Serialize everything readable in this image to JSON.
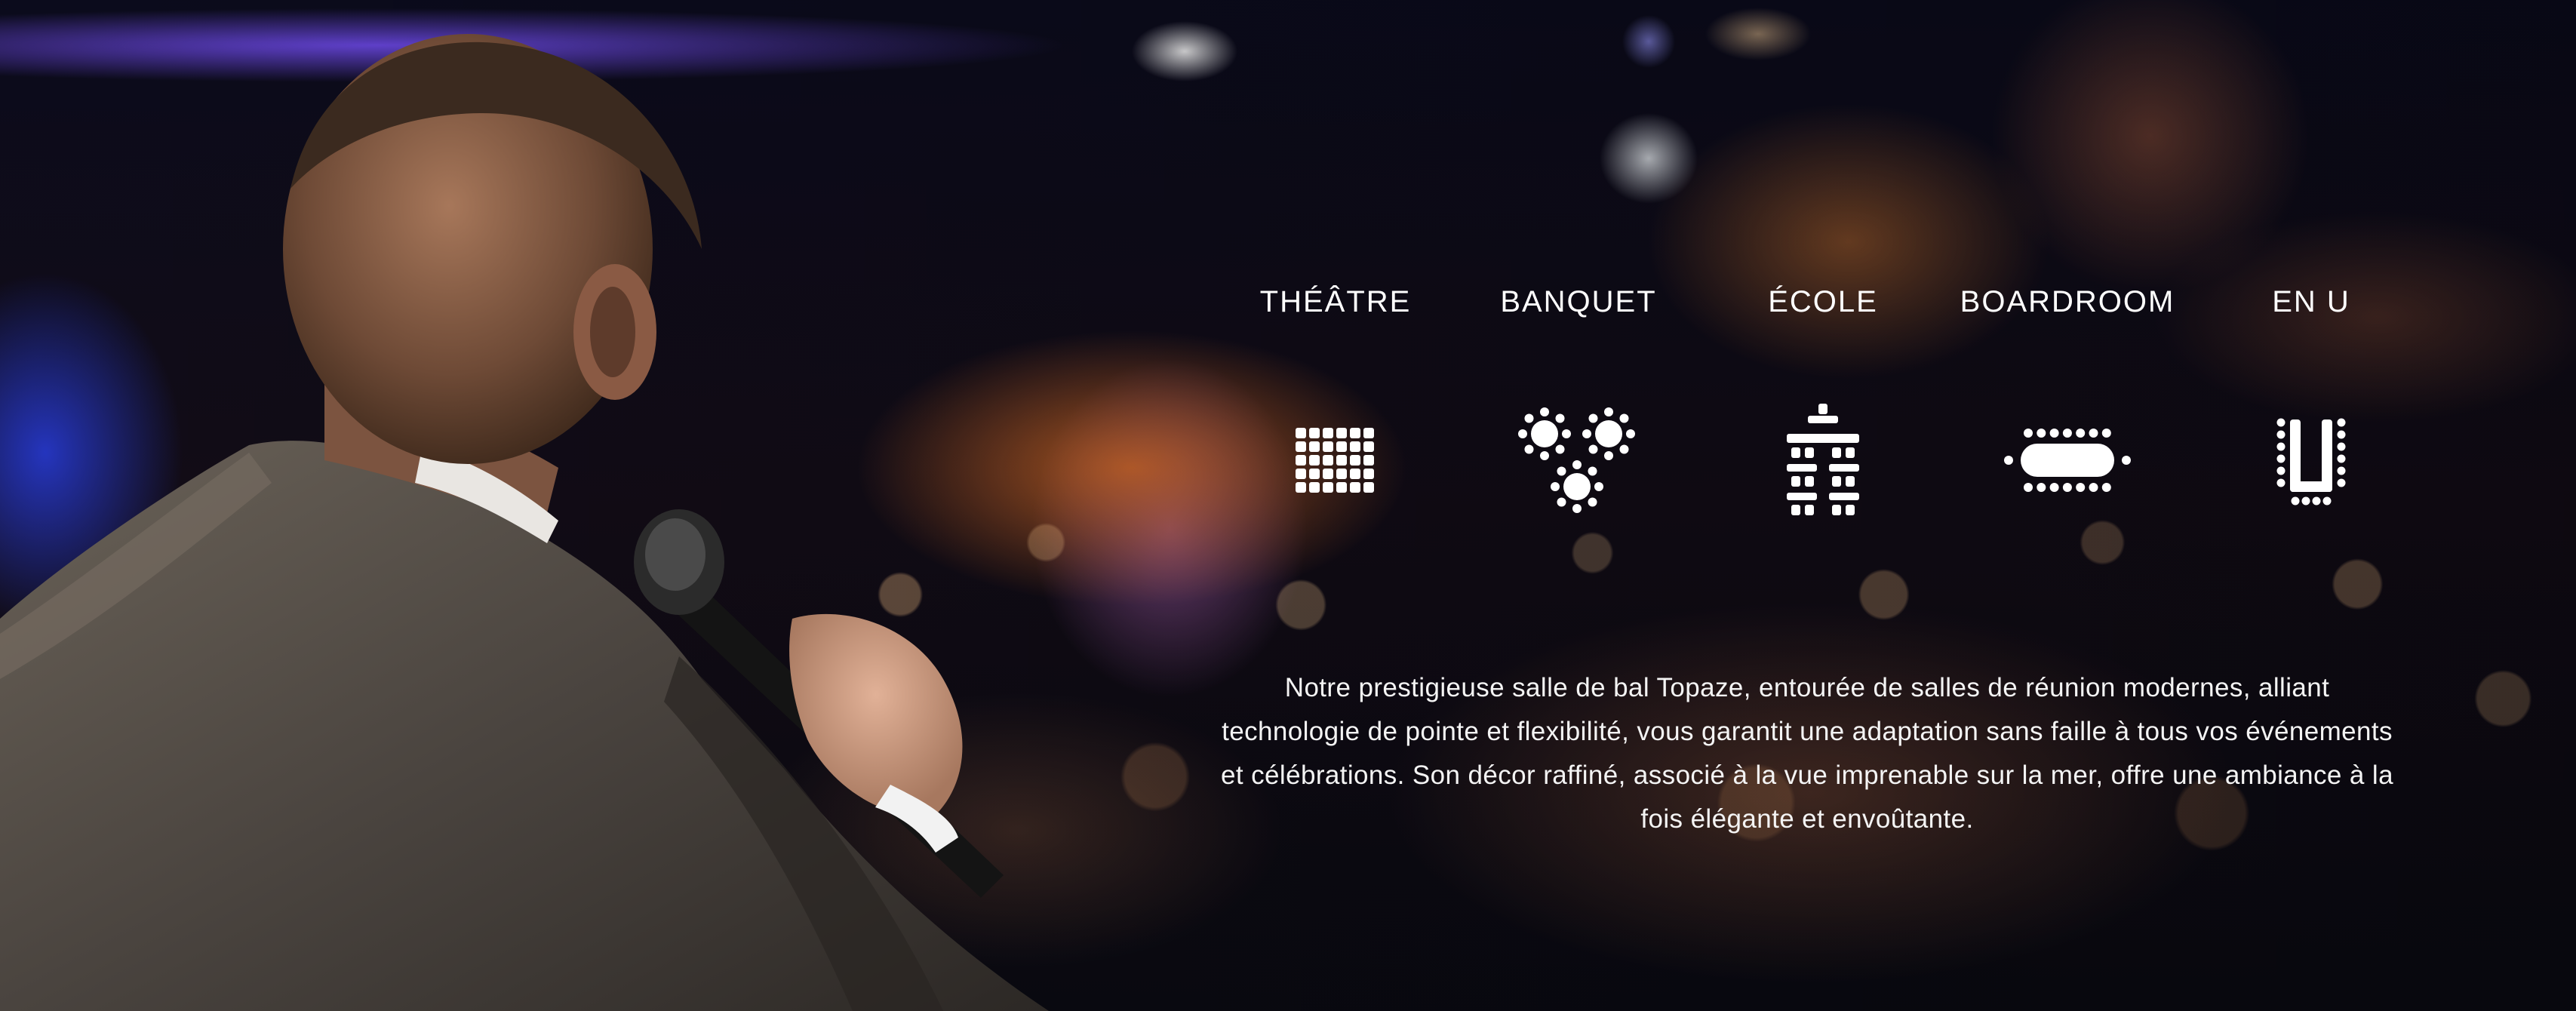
{
  "layouts": [
    {
      "id": "theatre",
      "label": "THÉÂTRE",
      "icon": "theatre-layout-icon"
    },
    {
      "id": "banquet",
      "label": "BANQUET",
      "icon": "banquet-layout-icon"
    },
    {
      "id": "ecole",
      "label": "ÉCOLE",
      "icon": "classroom-layout-icon"
    },
    {
      "id": "boardroom",
      "label": "BOARDROOM",
      "icon": "boardroom-layout-icon"
    },
    {
      "id": "en-u",
      "label": "EN U",
      "icon": "u-shape-layout-icon"
    }
  ],
  "description": "Notre prestigieuse salle de bal Topaze, entourée de salles de réunion modernes, alliant technologie de pointe et flexibilité, vous garantit une adaptation sans faille à tous vos événements et célébrations. Son décor raffiné, associé à la vue imprenable sur la mer, offre une ambiance à la fois élégante et envoûtante.",
  "colors": {
    "text": "#ffffff",
    "icon": "#ffffff"
  }
}
